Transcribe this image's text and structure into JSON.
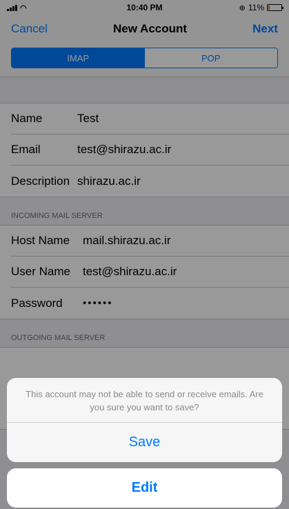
{
  "status_bar": {
    "time": "10:40 PM",
    "battery_percent": "11%",
    "battery_level": 0.11
  },
  "nav": {
    "cancel": "Cancel",
    "title": "New Account",
    "next": "Next"
  },
  "segments": {
    "imap": "IMAP",
    "pop": "POP",
    "selected": "IMAP"
  },
  "account": {
    "name_label": "Name",
    "name_value": "Test",
    "email_label": "Email",
    "email_value": "test@shirazu.ac.ir",
    "description_label": "Description",
    "description_value": "shirazu.ac.ir"
  },
  "incoming": {
    "header": "INCOMING MAIL SERVER",
    "host_label": "Host Name",
    "host_value": "mail.shirazu.ac.ir",
    "user_label": "User Name",
    "user_value": "test@shirazu.ac.ir",
    "password_label": "Password",
    "password_value": "••••••"
  },
  "outgoing": {
    "header": "OUTGOING MAIL SERVER"
  },
  "alert": {
    "message": "This account may not be able to send or receive emails. Are you sure you want to save?",
    "save": "Save",
    "edit": "Edit"
  },
  "colors": {
    "accent": "#007aff",
    "battery_low": "#ff3b30"
  }
}
